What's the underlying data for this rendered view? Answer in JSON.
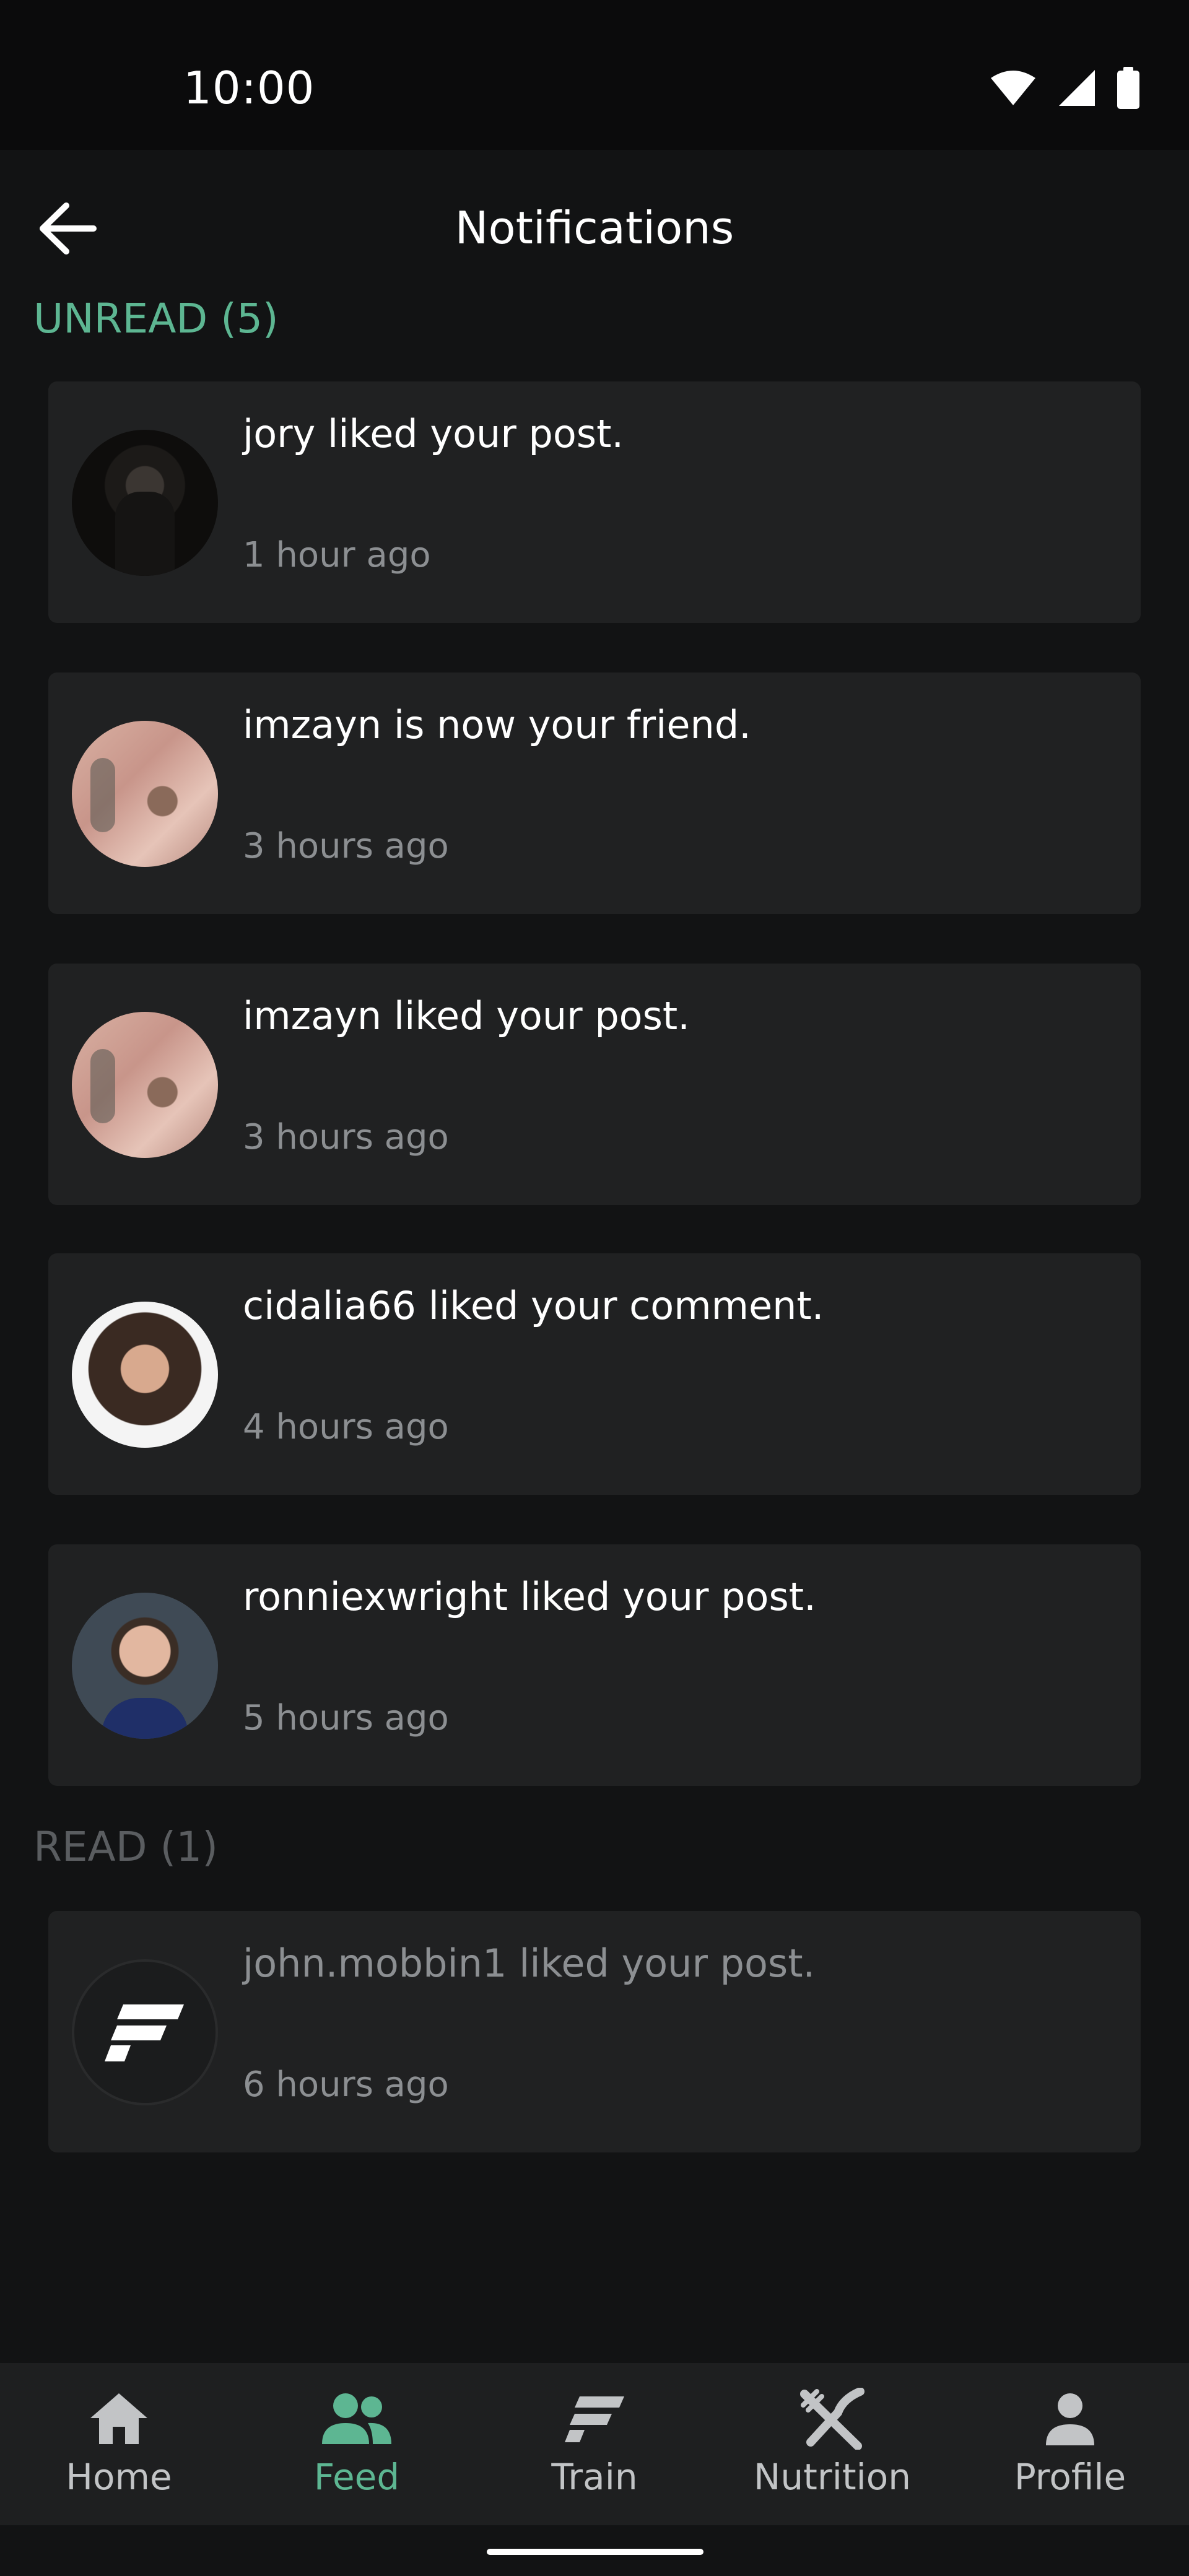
{
  "status_bar": {
    "time": "10:00"
  },
  "header": {
    "title": "Notifications"
  },
  "sections": {
    "unread_label": "UNREAD (5)",
    "read_label": "READ (1)"
  },
  "notifications": [
    {
      "text": "jory liked your post.",
      "time": "1 hour ago",
      "avatar": "photo"
    },
    {
      "text": "imzayn is now your friend.",
      "time": "3 hours ago",
      "avatar": "photo"
    },
    {
      "text": "imzayn liked your post.",
      "time": "3 hours ago",
      "avatar": "photo"
    },
    {
      "text": "cidalia66 liked your comment.",
      "time": "4 hours ago",
      "avatar": "photo"
    },
    {
      "text": "ronniexwright liked your post.",
      "time": "5 hours ago",
      "avatar": "photo"
    },
    {
      "text": "john.mobbin1 liked your post.",
      "time": "6 hours ago",
      "avatar": "app-logo"
    }
  ],
  "nav": {
    "items": [
      {
        "label": "Home",
        "icon": "home-icon"
      },
      {
        "label": "Feed",
        "icon": "people-icon",
        "active": true
      },
      {
        "label": "Train",
        "icon": "train-logo-icon"
      },
      {
        "label": "Nutrition",
        "icon": "utensils-icon"
      },
      {
        "label": "Profile",
        "icon": "person-icon"
      }
    ]
  },
  "colors": {
    "accent": "#5db692",
    "background": "#121314",
    "card": "#202122"
  }
}
